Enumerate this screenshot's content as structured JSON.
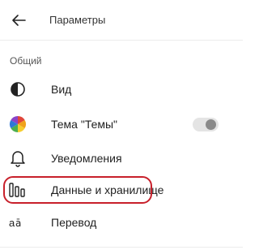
{
  "header": {
    "back_icon": "back-arrow-icon",
    "title": "Параметры"
  },
  "section": {
    "label": "Общий"
  },
  "items": [
    {
      "id": "view",
      "label": "Вид",
      "icon": "contrast-icon"
    },
    {
      "id": "theme",
      "label": "Тема \"Темы\"",
      "icon": "color-wheel-icon",
      "toggle": {
        "on": false
      }
    },
    {
      "id": "notifications",
      "label": "Уведомления",
      "icon": "bell-icon"
    },
    {
      "id": "data",
      "label": "Данные и хранилище",
      "icon": "storage-bars-icon",
      "highlighted": true,
      "highlight_color": "#c8202b"
    },
    {
      "id": "translate",
      "label": "Перевод",
      "icon": "translate-icon"
    }
  ]
}
